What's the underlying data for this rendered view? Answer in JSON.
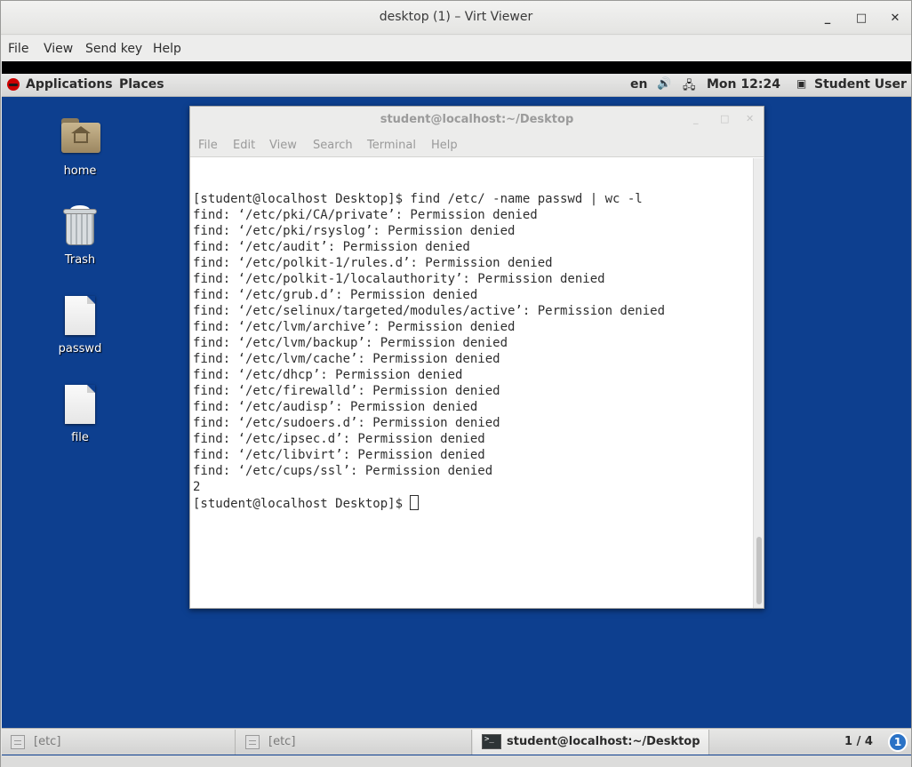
{
  "viewer": {
    "title": "desktop (1) – Virt Viewer",
    "menu": [
      "File",
      "View",
      "Send key",
      "Help"
    ],
    "controls": {
      "minimize": "_",
      "maximize": "□",
      "close": "✕"
    }
  },
  "top_panel": {
    "applications": "Applications",
    "places": "Places",
    "lang": "en",
    "clock": "Mon 12:24",
    "user": "Student User"
  },
  "desktop_icons": [
    {
      "label": "home",
      "icon": "home-folder-icon"
    },
    {
      "label": "Trash",
      "icon": "trash-icon"
    },
    {
      "label": "passwd",
      "icon": "file-icon"
    },
    {
      "label": "file",
      "icon": "file-icon"
    }
  ],
  "terminal": {
    "title": "student@localhost:~/Desktop",
    "menu": [
      "File",
      "Edit",
      "View",
      "Search",
      "Terminal",
      "Help"
    ],
    "lines": [
      "[student@localhost Desktop]$ find /etc/ -name passwd | wc -l",
      "find: ‘/etc/pki/CA/private’: Permission denied",
      "find: ‘/etc/pki/rsyslog’: Permission denied",
      "find: ‘/etc/audit’: Permission denied",
      "find: ‘/etc/polkit-1/rules.d’: Permission denied",
      "find: ‘/etc/polkit-1/localauthority’: Permission denied",
      "find: ‘/etc/grub.d’: Permission denied",
      "find: ‘/etc/selinux/targeted/modules/active’: Permission denied",
      "find: ‘/etc/lvm/archive’: Permission denied",
      "find: ‘/etc/lvm/backup’: Permission denied",
      "find: ‘/etc/lvm/cache’: Permission denied",
      "find: ‘/etc/dhcp’: Permission denied",
      "find: ‘/etc/firewalld’: Permission denied",
      "find: ‘/etc/audisp’: Permission denied",
      "find: ‘/etc/sudoers.d’: Permission denied",
      "find: ‘/etc/ipsec.d’: Permission denied",
      "find: ‘/etc/libvirt’: Permission denied",
      "find: ‘/etc/cups/ssl’: Permission denied",
      "2"
    ],
    "prompt": "[student@localhost Desktop]$ "
  },
  "taskbar": {
    "tasks": [
      {
        "label": "[etc]",
        "active": false
      },
      {
        "label": "[etc]",
        "active": false
      },
      {
        "label": "student@localhost:~/Desktop",
        "active": true
      }
    ],
    "pager": "1 / 4",
    "notification_badge": "1"
  },
  "colors": {
    "desktop_bg": "#0d3f8f",
    "panel_bg": "#e0e0df",
    "terminal_text": "#2e2e2e"
  }
}
